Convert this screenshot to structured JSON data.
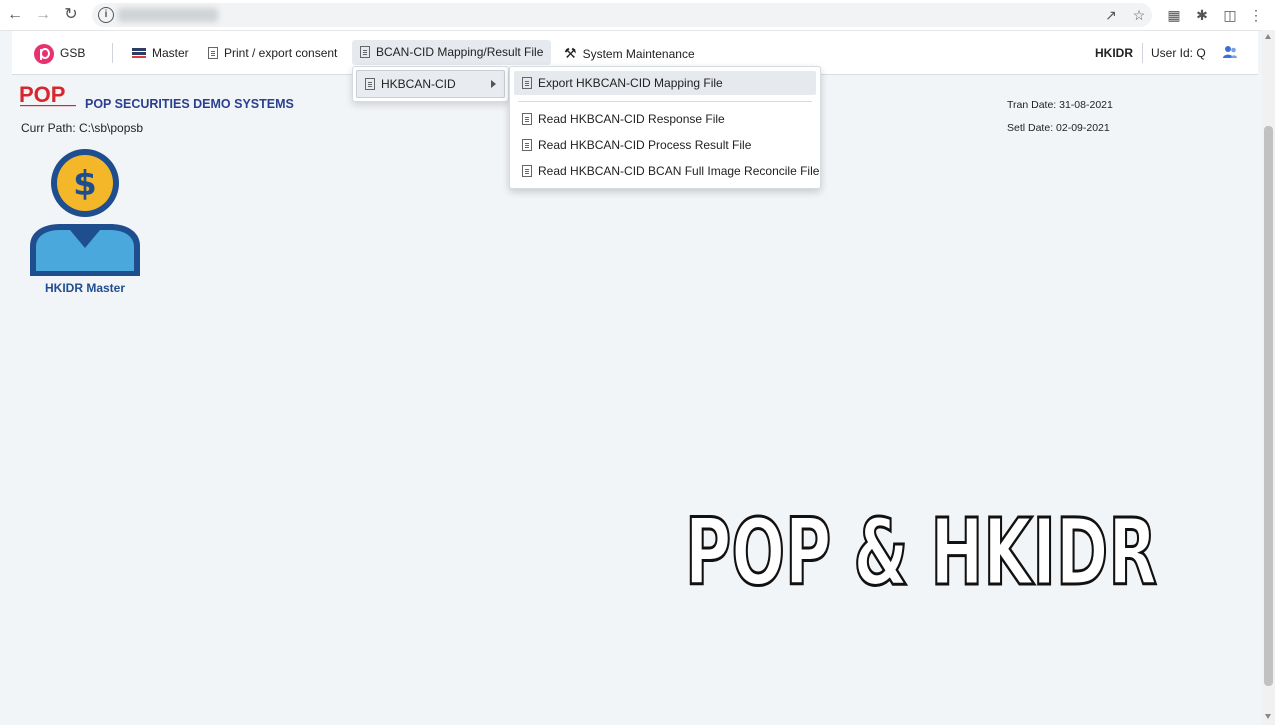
{
  "browser": {
    "url": ""
  },
  "menubar": {
    "gsb": "GSB",
    "master": "Master",
    "print_export": "Print / export consent",
    "bcan_mapping": "BCAN-CID Mapping/Result File",
    "system_maintenance": "System Maintenance",
    "system_name": "HKIDR",
    "user_id": "User Id: Q"
  },
  "submenu1": {
    "item": "HKBCAN-CID"
  },
  "submenu2": {
    "items": [
      "Export HKBCAN-CID Mapping File",
      "Read HKBCAN-CID Response File",
      "Read HKBCAN-CID Process Result File",
      "Read HKBCAN-CID BCAN Full Image Reconcile File"
    ]
  },
  "header": {
    "logo_text": "POP",
    "company": "POP SECURITIES DEMO SYSTEMS",
    "curr_path": "Curr Path: C:\\sb\\popsb",
    "tran_date": "Tran Date: 31-08-2021",
    "setl_date": "Setl Date: 02-09-2021"
  },
  "tile": {
    "label": "HKIDR Master"
  },
  "watermark": {
    "text": "POP & HKIDR"
  },
  "colors": {
    "accent_blue": "#2a3f8f",
    "tile_blue": "#1f4e8f",
    "gold": "#f5b72a",
    "gsb_pink": "#e8316f"
  }
}
